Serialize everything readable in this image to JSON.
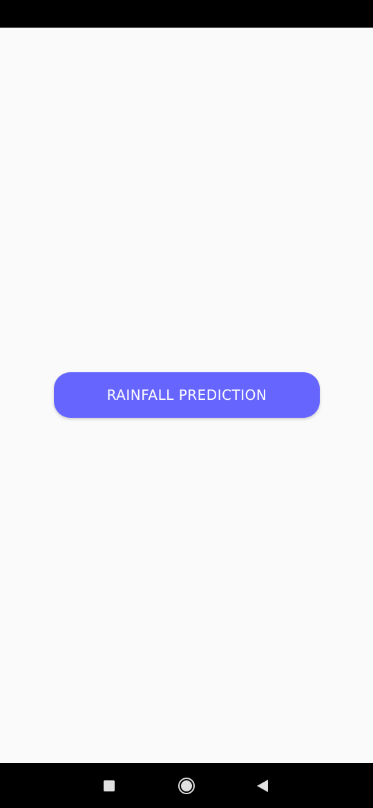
{
  "main": {
    "button_label": "RAINFALL PREDICTION"
  },
  "colors": {
    "background": "#fafafa",
    "button": "#6666ff",
    "button_text": "#ffffff",
    "system_bars": "#000000"
  },
  "nav_bar": {
    "icons": [
      "recents-icon",
      "home-icon",
      "back-icon"
    ]
  }
}
